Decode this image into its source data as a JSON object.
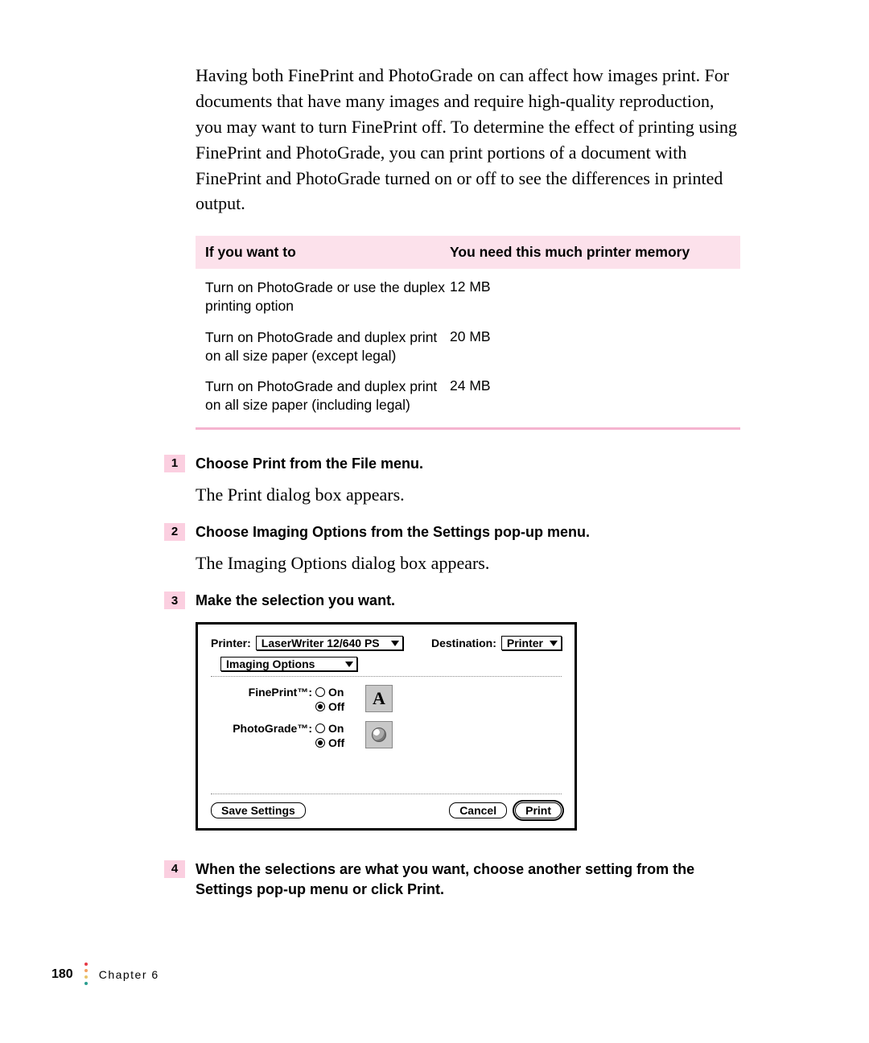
{
  "intro": "Having both FinePrint and PhotoGrade on can affect how images print. For documents that have many images and require high-quality reproduction, you may want to turn FinePrint off. To determine the effect of printing using FinePrint and PhotoGrade, you can print portions of a document with FinePrint and PhotoGrade turned on or off to see the differences in printed output.",
  "table": {
    "header": {
      "c1": "If you want to",
      "c2": "You need this much printer memory"
    },
    "rows": [
      {
        "c1": "Turn on PhotoGrade or use the duplex printing option",
        "c2": "12 MB"
      },
      {
        "c1": "Turn on PhotoGrade and duplex print on all size paper (except legal)",
        "c2": "20 MB"
      },
      {
        "c1": "Turn on PhotoGrade and duplex print on all size paper (including legal)",
        "c2": "24 MB"
      }
    ]
  },
  "steps": {
    "s1": {
      "n": "1",
      "title": "Choose Print from the File menu.",
      "body": "The Print dialog box appears."
    },
    "s2": {
      "n": "2",
      "title": "Choose Imaging Options from the Settings pop-up menu.",
      "body": "The Imaging Options dialog box appears."
    },
    "s3": {
      "n": "3",
      "title": "Make the selection you want."
    },
    "s4": {
      "n": "4",
      "title": "When the selections are what you want, choose another setting from the Settings pop-up menu or click Print."
    }
  },
  "dialog": {
    "printer_label": "Printer:",
    "printer_value": "LaserWriter 12/640 PS",
    "destination_label": "Destination:",
    "destination_value": "Printer",
    "settings_value": "Imaging Options",
    "fineprint": {
      "label": "FinePrint™:",
      "on": "On",
      "off": "Off",
      "selected": "off",
      "glyph": "A"
    },
    "photograde": {
      "label": "PhotoGrade™:",
      "on": "On",
      "off": "Off",
      "selected": "off"
    },
    "buttons": {
      "save": "Save Settings",
      "cancel": "Cancel",
      "print": "Print"
    }
  },
  "footer": {
    "page": "180",
    "chapter": "Chapter 6"
  },
  "colors": {
    "accent": "#fbcfe0",
    "table_header": "#fce1eb",
    "dot1": "#e63946",
    "dot2": "#f4a261",
    "dot3": "#e9c46a",
    "dot4": "#2a9d8f"
  }
}
